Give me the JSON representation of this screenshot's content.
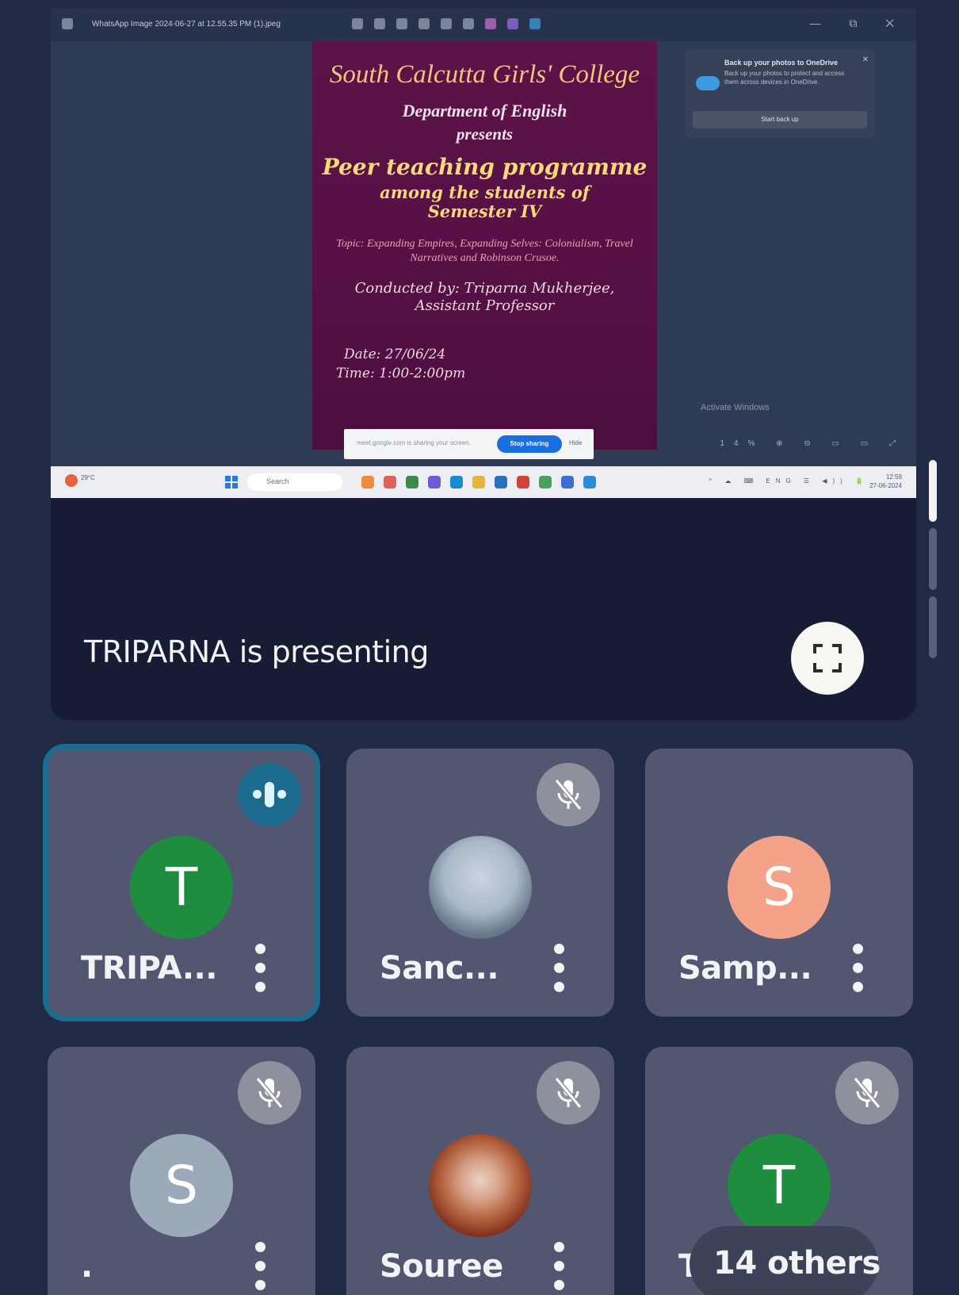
{
  "window": {
    "file_title": "WhatsApp Image 2024-06-27 at 12.55.35 PM (1).jpeg",
    "controls": "—  ⧉  ✕"
  },
  "poster": {
    "college": "South Calcutta Girls' College",
    "department": "Department of English",
    "presents": "presents",
    "program": "Peer teaching programme",
    "among": "among the students of",
    "semester": "Semester IV",
    "topic": "Topic: Expanding Empires, Expanding Selves: Colonialism, Travel Narratives and Robinson Crusoe.",
    "conducted_line1": "Conducted by: Triparna Mukherjee,",
    "conducted_line2": "Assistant Professor",
    "date": "Date: 27/06/24",
    "time": "Time: 1:00-2:00pm"
  },
  "onedrive_popup": {
    "title": "Back up your photos to OneDrive",
    "body": "Back up your photos to protect and access them across devices in OneDrive.",
    "close": "✕",
    "button": "Start back up"
  },
  "desktop": {
    "activate_windows": "Activate Windows",
    "share_bar_text": "meet.google.com is sharing your screen.",
    "stop_sharing": "Stop sharing",
    "hide": "Hide",
    "status_icons": "14%  ⊕  ⊖  ▭  ▭  ⤢",
    "search_placeholder": "Search",
    "weather": "29°C",
    "tray": "^ ☁ ⌨ ENG ☰ ◀)) 🔋",
    "clock_time": "12:59",
    "clock_date": "27-06-2024"
  },
  "presentation": {
    "presenter_label": "TRIPARNA is presenting",
    "fullscreen_icon": "fullscreen-icon"
  },
  "participants": [
    {
      "name": "TRIPA...",
      "initial": "T",
      "color": "#1e8e3e",
      "state": "speaking"
    },
    {
      "name": "Sanc...",
      "initial": "",
      "color": "#aab8c8",
      "state": "muted"
    },
    {
      "name": "Samp...",
      "initial": "S",
      "color": "#f4a38a",
      "state": "none"
    },
    {
      "name": ".",
      "initial": "S",
      "color": "#9ba9b9",
      "state": "muted"
    },
    {
      "name": "Souree",
      "initial": "",
      "color": "#c0603c",
      "state": "muted"
    },
    {
      "name": "TR",
      "initial": "T",
      "color": "#1e8e3e",
      "state": "muted"
    }
  ],
  "others": {
    "label": "14 others"
  },
  "colors": {
    "background": "#202a44",
    "tile": "#525670",
    "active_outline": "#1c6b8f",
    "mic_off_bg": "#8e909c"
  }
}
